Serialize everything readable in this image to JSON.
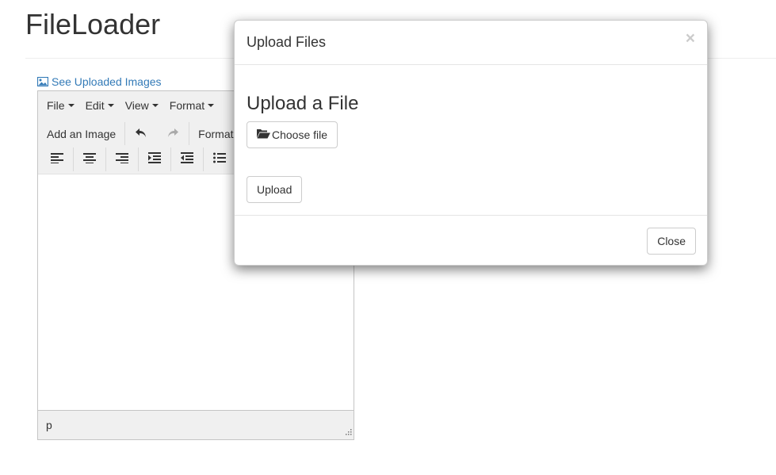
{
  "page": {
    "title": "FileLoader"
  },
  "uploaded_link": {
    "label": "See Uploaded Images",
    "icon": "image-icon",
    "color": "#337ab7"
  },
  "editor": {
    "menubar": [
      {
        "label": "File"
      },
      {
        "label": "Edit"
      },
      {
        "label": "View"
      },
      {
        "label": "Format"
      }
    ],
    "toolbar": {
      "add_image_label": "Add an Image",
      "undo_icon": "undo-icon",
      "redo_icon": "redo-icon",
      "formats_label": "Formats"
    },
    "alignment_icons": [
      "align-left-icon",
      "align-center-icon",
      "align-right-icon",
      "indent-icon",
      "outdent-icon",
      "bullet-list-icon"
    ],
    "status_path": "p"
  },
  "modal": {
    "title": "Upload Files",
    "close_symbol": "×",
    "heading": "Upload a File",
    "choose_file_label": "Choose file",
    "choose_icon": "folder-open-icon",
    "upload_label": "Upload",
    "close_label": "Close"
  }
}
